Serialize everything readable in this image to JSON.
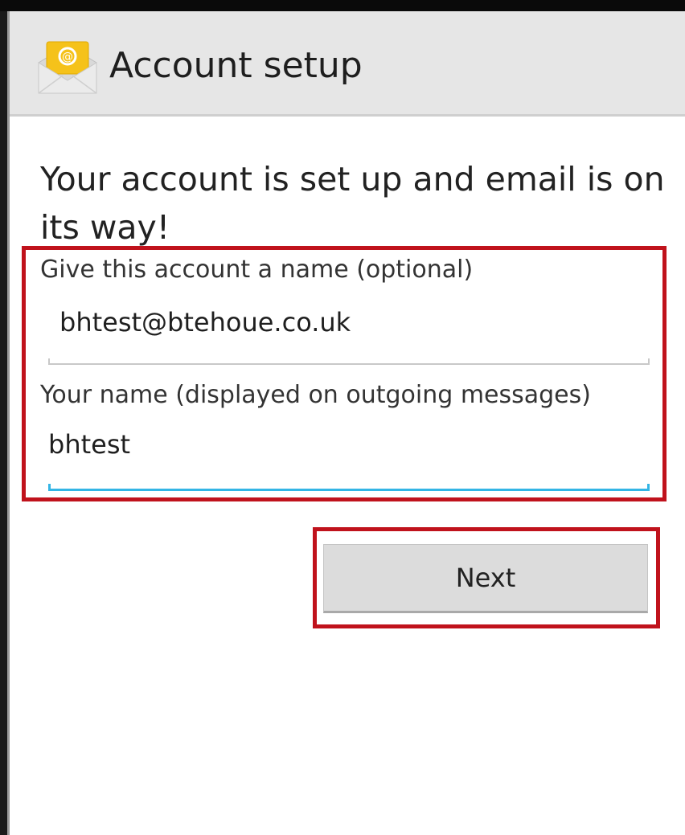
{
  "action_bar": {
    "title": "Account setup",
    "icon": "email-app-icon"
  },
  "content": {
    "headline": "Your account is set up and email is on its way!",
    "account_name": {
      "label": "Give this account a name (optional)",
      "value": "bhtest@btehoue.co.uk"
    },
    "your_name": {
      "label": "Your name (displayed on outgoing messages)",
      "value": "bhtest"
    },
    "next_label": "Next"
  },
  "colors": {
    "highlight": "#c0121c",
    "focus_underline": "#33b5e5",
    "action_bar_bg": "#e6e6e6"
  }
}
